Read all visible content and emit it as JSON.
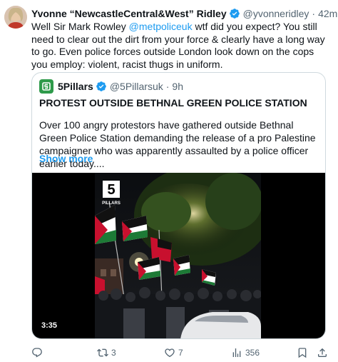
{
  "author": {
    "name": "Yvonne “NewcastleCentral&West” Ridley",
    "handle": "@yvonneridley",
    "time": "42m"
  },
  "body": {
    "before": "Well Sir Mark Rowley ",
    "mention": "@metpoliceuk",
    "after": " wtf did you expect? You still need to clear out the dirt from your force & clearly have a long way to go. Even police forces outside London look down on the cops you employ: violent, racist thugs in uniform."
  },
  "quote": {
    "name": "5Pillars",
    "handle": "@5Pillarsuk",
    "time": "9h",
    "title": "PROTEST OUTSIDE BETHNAL GREEN POLICE STATION",
    "text": "Over 100 angry protestors have gathered outside Bethnal Green Police Station demanding the release of a pro Palestine campaigner who was apparently assaulted by a police officer earlier today....",
    "show_more": "Show more",
    "video": {
      "logo_text": "5",
      "logo_sub": "PILLARS",
      "duration": "3:35"
    }
  },
  "actions": {
    "replies": "",
    "retweets": "3",
    "likes": "7",
    "views": "356"
  },
  "colors": {
    "accent": "#1d9bf0",
    "muted": "#536471",
    "border": "#cfd9de"
  },
  "icons": [
    "verified-badge-icon",
    "more-icon",
    "reply-icon",
    "retweet-icon",
    "like-icon",
    "views-icon",
    "bookmark-icon",
    "share-icon"
  ]
}
